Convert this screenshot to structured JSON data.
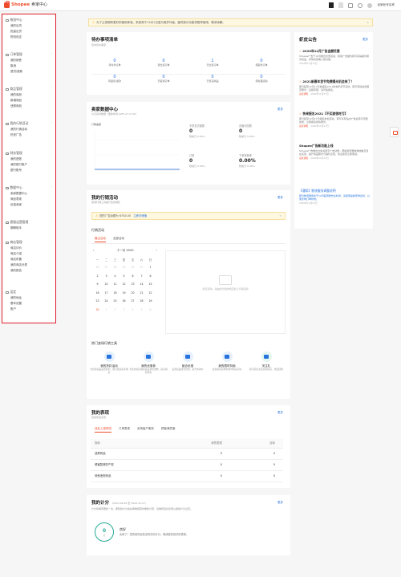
{
  "topbar": {
    "brand": "Shopee",
    "subtitle": "卖家中心",
    "username": "卖家帐号名称"
  },
  "sidebar": {
    "groups": [
      {
        "title": "物流中心",
        "items": [
          "我的出货",
          "批量出货",
          "物流设定"
        ]
      },
      {
        "title": "订单管理",
        "items": [
          "我的销售",
          "取消",
          "退货/退款"
        ]
      },
      {
        "title": "商品管理",
        "items": [
          "我的商品",
          "新增商品",
          "违规商品"
        ]
      },
      {
        "title": "我的行销活动",
        "items": [
          "我的行销活动",
          "虾皮广告"
        ]
      },
      {
        "title": "财务管理",
        "items": [
          "我的进账",
          "我的银行账户",
          "银行账号"
        ]
      },
      {
        "title": "数据中心",
        "items": [
          "卖家数据中心",
          "商品表现",
          "优选卖家"
        ]
      },
      {
        "title": "客服运营管理",
        "items": [
          "聊聊助手"
        ]
      },
      {
        "title": "商店管理",
        "items": [
          "商店评价",
          "商店介绍",
          "商店布置",
          "我的商店分类",
          "我的报告"
        ]
      },
      {
        "title": "设定",
        "items": [
          "我的地址",
          "基本设置",
          "账户"
        ]
      }
    ]
  },
  "notice": {
    "text": "为了让您拥有更好的使用体验，系统将于12月1日进行维护升级，届时部分功能将暂停使用，敬请谅解。"
  },
  "todo": {
    "title": "待办事项清单",
    "subtitle": "您的待办事项",
    "cells": [
      {
        "value": "0",
        "label": "待付款订单"
      },
      {
        "value": "0",
        "label": "待出货订单"
      },
      {
        "value": "1",
        "label": "已出货订单"
      },
      {
        "value": "0",
        "label": "待取件订单"
      },
      {
        "value": "0",
        "label": "待退货/退款"
      },
      {
        "value": "0",
        "label": "已取消订单"
      },
      {
        "value": "0",
        "label": "已售完商品"
      },
      {
        "value": "0",
        "label": "待处理活动"
      }
    ]
  },
  "metrics": {
    "title": "卖家数据中心",
    "subtitle": "今日实时数据（更新时间 GMT+8 17:00）",
    "more": "更多",
    "chart_label": "订购金额",
    "cards": [
      {
        "label": "不重复访客数",
        "value": "0",
        "compare": "较前日 0.00%"
      },
      {
        "label": "页面浏览数",
        "value": "0",
        "compare": "较前日 0.00%"
      },
      {
        "label": "订单",
        "value": "0",
        "compare": "较前日 0.00%"
      },
      {
        "label": "下单转换率",
        "value": "0.00%",
        "compare": "较前日 0.00%"
      }
    ]
  },
  "marketing": {
    "title": "我的行销活动",
    "subtitle": "使用行销工具提升您的销售",
    "more": "更多",
    "banner": "您的广告余额为 NT$0.00",
    "banner_link": "立即去储值",
    "section": "行销活动",
    "tabs": [
      "最近活动",
      "全部活动"
    ],
    "month": "十一月 2020",
    "weekdays": [
      "一",
      "二",
      "三",
      "四",
      "五",
      "六",
      "日"
    ],
    "calendar": [
      [
        "26",
        "27",
        "28",
        "29",
        "30",
        "31",
        "1"
      ],
      [
        "2",
        "3",
        "4",
        "5",
        "6",
        "7",
        "8"
      ],
      [
        "9",
        "10",
        "11",
        "12",
        "13",
        "14",
        "15"
      ],
      [
        "16",
        "17",
        "18",
        "19",
        "20",
        "21",
        "22"
      ],
      [
        "23",
        "24",
        "25",
        "26",
        "27",
        "28",
        "29"
      ],
      [
        "30",
        "1",
        "2",
        "3",
        "4",
        "5",
        "6"
      ]
    ],
    "empty_text": "尚无活动，请由此为您的商店加入行销活动",
    "tools_title": "热门卖场行销工具",
    "tools": [
      {
        "name": "我的折扣活动",
        "desc": "为您的商品设置折扣，吸引更多买家购买"
      },
      {
        "name": "我的优惠券",
        "desc": "为您的商店或商品设置优惠券，提高销售转化"
      },
      {
        "name": "组合优惠",
        "desc": "设置商品组合优惠，提升客单价"
      },
      {
        "name": "我的限时特卖",
        "desc": "在您的商店举办限时特卖活动"
      },
      {
        "name": "关注礼",
        "desc": "吸引买家关注您的商店，增加回购"
      }
    ]
  },
  "performance": {
    "title": "我的表现",
    "subtitle": "您的商店表现",
    "more": "更多",
    "tabs": [
      "违反上架规范",
      "订单表现",
      "卖场客户服务",
      "顾客满意度"
    ],
    "columns": [
      "指标",
      "我的表现",
      "目标"
    ],
    "rows": [
      {
        "name": "违禁商品",
        "mine": "0",
        "target": "0"
      },
      {
        "name": "侵害智慧财产权",
        "mine": "0",
        "target": "0"
      },
      {
        "name": "其他违规商品",
        "mine": "0",
        "target": "0"
      }
    ]
  },
  "points": {
    "title": "我的计分",
    "period": "（2020-09-28 至 2020-12-27）",
    "desc": "计分将每周更新一次，累积的计分会在每季结束时重新计算，请维持良好表现以避免计分过高。",
    "more": "更多",
    "score": "0",
    "score_unit": "分",
    "status": "良好",
    "status_desc": "太棒了！您的卖场目前没有任何计分，继续保持良好的表现。"
  },
  "announcements": {
    "title": "虾皮公告",
    "more": "更多",
    "items": [
      {
        "title": "2020年12月广告金额优惠",
        "body": "Shopee广告于12月推出优惠活动，使用广告服务即可获得额外曝光机会，详情请查看公告内容。",
        "date": "2020年11月15日",
        "tag": "",
        "hot": true
      },
      {
        "title": "2021新春年货节免费曝光机会来了！",
        "body": "即日起至12月17日前报名2021新春年货节活动，即可获得免费首页曝光，名额有限，请尽速报名。",
        "date": "2020年11月27日",
        "tag": "卖家通知",
        "hot": true
      },
      {
        "title": "快来报名2021【不买就很吃亏】",
        "body": "即日起至12月17日报名参加活动，即可享有站内广告资源与流量加成，立即报名抢先曝光。",
        "date": "2020年11月27日",
        "tag": "卖家通知",
        "hot": true
      },
      {
        "title": "Shopee广告新功能上线",
        "body": "Shopee广告推出全新关键字广告功能，帮助卖家更精准地触及潜在买家，提升商品曝光与销售表现，欢迎卖家立即使用。",
        "date": "2020年11月25日",
        "tag": "卖家通知",
        "hot": false
      },
      {
        "title": "【通知】物流服务调整说明",
        "body": "部分物流服务将于12月起调整作业时间，请卖家提前安排出货，以免影响订单时效。",
        "date": "2020年11月23日",
        "tag": "",
        "hot": false
      }
    ]
  },
  "colors": {
    "brand": "#ee4d2d",
    "link": "#2673dd",
    "highlight_box": "#e0202a"
  },
  "icons": [
    "shopee-bag-icon",
    "grid-icon",
    "bell-icon",
    "chat-icon",
    "calendar-icon",
    "fire-icon"
  ]
}
